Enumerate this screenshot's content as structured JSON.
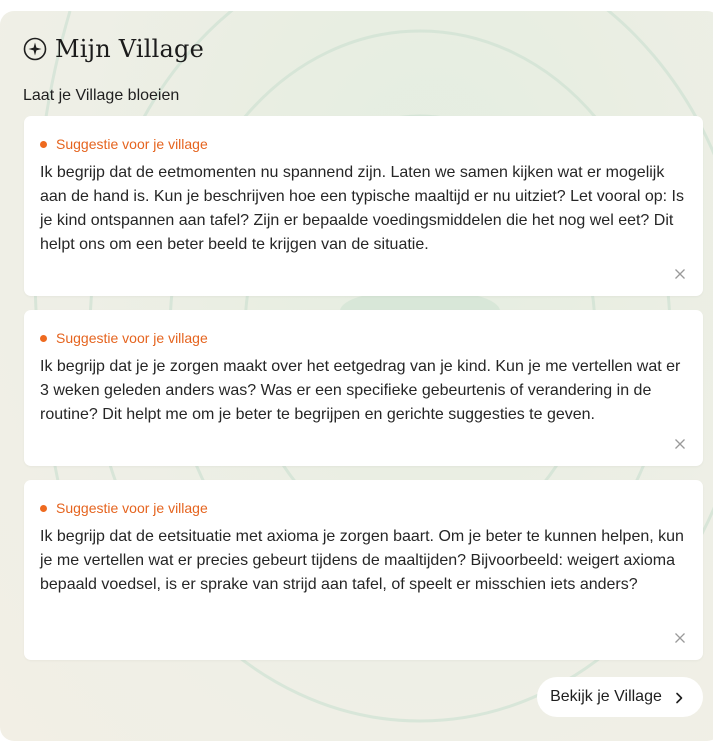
{
  "header": {
    "title": "Mijn Village",
    "subtitle": "Laat je Village bloeien",
    "icon": "sparkle-compass-icon"
  },
  "suggestions": [
    {
      "tag": "Suggestie voor je village",
      "text": "Ik begrijp dat de eetmomenten nu spannend zijn. Laten we samen kijken wat er mogelijk aan de hand is. Kun je beschrijven hoe een typische maaltijd er nu uitziet? Let vooral op: Is je kind ontspannen aan tafel? Zijn er bepaalde voedingsmiddelen die het nog wel eet? Dit helpt ons om een beter beeld te krijgen van de situatie."
    },
    {
      "tag": "Suggestie voor je village",
      "text": "Ik begrijp dat je je zorgen maakt over het eetgedrag van je kind. Kun je me vertellen wat er 3 weken geleden anders was? Was er een specifieke gebeurtenis of verandering in de routine? Dit helpt me om je beter te begrijpen en gerichte suggesties te geven."
    },
    {
      "tag": "Suggestie voor je village",
      "text": "Ik begrijp dat de eetsituatie met axioma je zorgen baart. Om je beter te kunnen helpen, kun je me vertellen wat er precies gebeurt tijdens de maaltijden? Bijvoorbeeld: weigert axioma bepaald voedsel, is er sprake van strijd aan tafel, of speelt er misschien iets anders?"
    }
  ],
  "footer": {
    "button_label": "Bekijk je Village"
  },
  "colors": {
    "accent": "#ee6a1f",
    "card_bg": "#ffffff",
    "panel_bg": "#eeefe6",
    "text": "#262626"
  }
}
